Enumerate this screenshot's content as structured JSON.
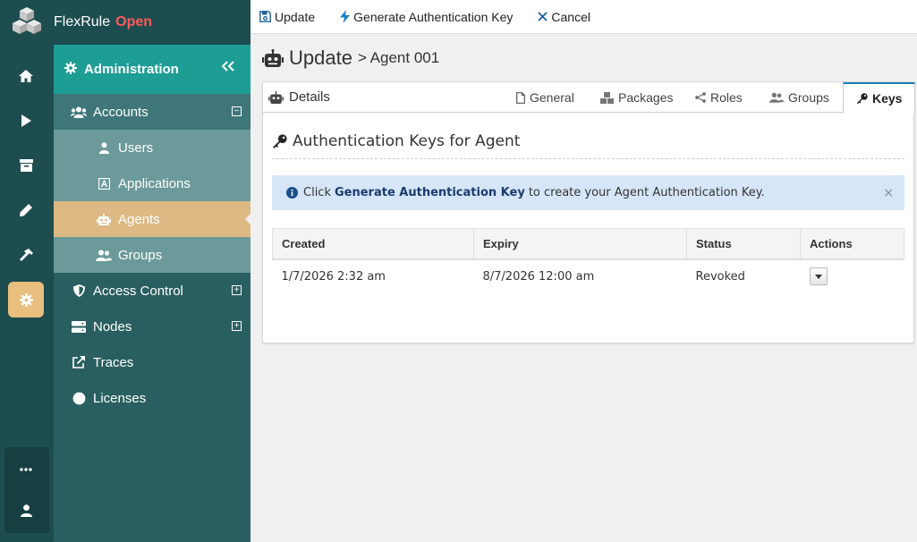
{
  "brand": {
    "name": "FlexRule",
    "edition": "Open"
  },
  "rail": {
    "items": [
      "home-icon",
      "play-icon",
      "archive-icon",
      "pencil-icon",
      "hammer-icon",
      "gear-icon"
    ],
    "active": "gear-icon",
    "bottom": [
      "more-icon",
      "user-icon"
    ]
  },
  "sidebar": {
    "header": "Administration",
    "items": [
      {
        "label": "Accounts",
        "icon": "users-icon",
        "toggle": "⊟"
      },
      {
        "label": "Users",
        "icon": "user-icon"
      },
      {
        "label": "Applications",
        "icon": "application-icon"
      },
      {
        "label": "Agents",
        "icon": "robot-icon"
      },
      {
        "label": "Groups",
        "icon": "group-icon"
      },
      {
        "label": "Access Control",
        "icon": "shield-icon",
        "toggle": "⊞"
      },
      {
        "label": "Nodes",
        "icon": "server-icon",
        "toggle": "⊞"
      },
      {
        "label": "Traces",
        "icon": "external-link-icon"
      },
      {
        "label": "Licenses",
        "icon": "badge-icon"
      }
    ]
  },
  "toolbar": {
    "update": "Update",
    "generate": "Generate Authentication Key",
    "cancel": "Cancel"
  },
  "title": {
    "main": "Update",
    "crumb": "> Agent 001"
  },
  "tabs": {
    "details": "Details",
    "general": "General",
    "packages": "Packages",
    "roles": "Roles",
    "groups": "Groups",
    "keys": "Keys"
  },
  "section": {
    "title": "Authentication Keys for Agent"
  },
  "alert": {
    "prefix": "Click",
    "link": "Generate Authentication Key",
    "suffix": "to create your Agent Authentication Key.",
    "close": "×"
  },
  "table": {
    "headers": [
      "Created",
      "Expiry",
      "Status",
      "Actions"
    ],
    "rows": [
      {
        "created": "1/7/2026 2:32 am",
        "expiry": "8/7/2026 12:00 am",
        "status": "Revoked"
      }
    ]
  },
  "colors": {
    "rail": "#1d4d4f",
    "accent": "#1e9d95",
    "active": "#ddb983",
    "brandOpen": "#ff5a5a"
  }
}
